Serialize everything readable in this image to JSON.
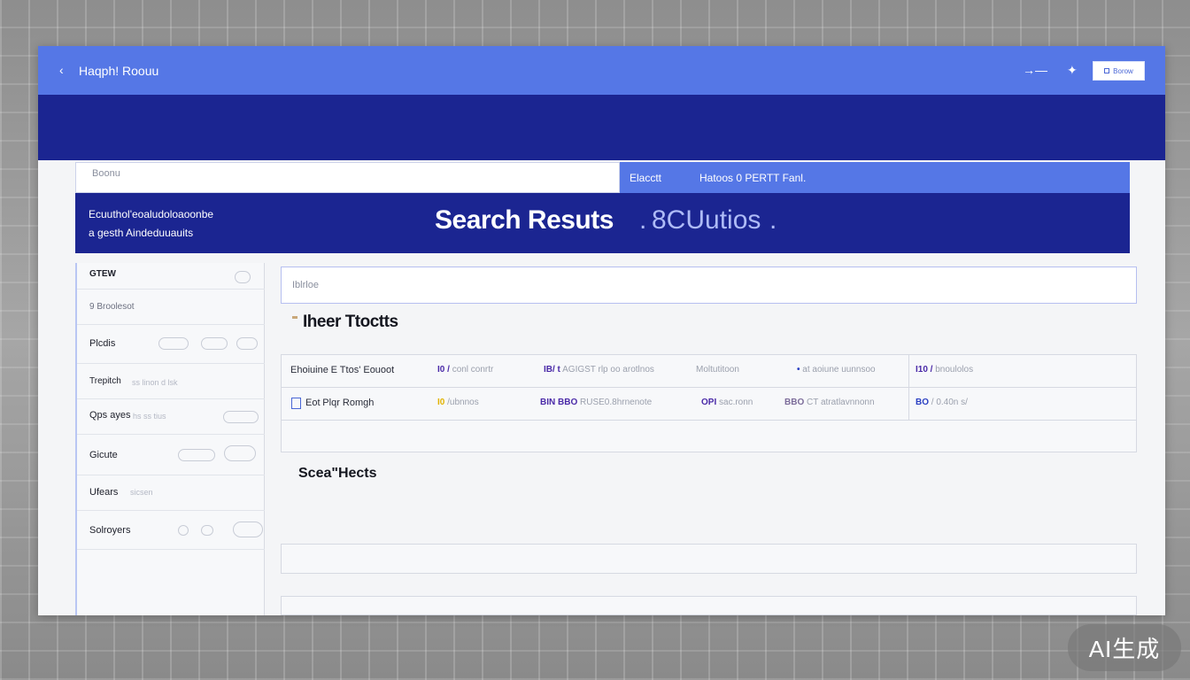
{
  "header": {
    "app_title": "Haqph! Roouu",
    "top_button_label": "Borow"
  },
  "search": {
    "placeholder": "Boonu",
    "filter_primary": "Elacctt",
    "filter_secondary": "Hatoos 0 PERTT Fanl."
  },
  "hero": {
    "subtitle_line1": "Ecuuthol'eoaludoloaoonbe",
    "subtitle_line2": "a gesth Aindeduuauits",
    "title": "Search Resuts",
    "title_sep": ".",
    "title_count": "8CUutios",
    "title_dot": "."
  },
  "sidebar": {
    "items": [
      {
        "label": "GTEW",
        "meta": ""
      },
      {
        "label": "9 Broolesot",
        "meta": ""
      },
      {
        "label": "Plcdis",
        "meta": ""
      },
      {
        "label": "Trepitch",
        "meta": "ss  linon      d  lsk"
      },
      {
        "label": "Qps ayes",
        "meta": "hs  ss  tius"
      },
      {
        "label": "Gicute",
        "meta": ""
      },
      {
        "label": "Ufears",
        "meta": "sicsen"
      },
      {
        "label": "Solroyers",
        "meta": ""
      }
    ]
  },
  "main": {
    "filter_placeholder": "Iblrloe",
    "section1_title": "Iheer Ttoctts",
    "section2_title": "Scea\"Hects",
    "rows": [
      {
        "c1a": "Ehoiuine",
        "c1b": "E Ttos' Eouoot",
        "c2a": "I0 /",
        "c2b": "conl conrtr",
        "c3a": "IB/ t",
        "c3b": "AGIGST rlp oo arotlnos",
        "c4": "Moltutitoon",
        "c5a": "•",
        "c5b": "at aoiune uunnsoo",
        "c6a": "I10 /",
        "c6b": "bnoulolos"
      },
      {
        "c1a": "Eot",
        "c1b": "Plqr Romgh",
        "c2a": "I0",
        "c2b": "/ubnnos",
        "c3a": "BIN BBO",
        "c3b": "RUSE0.8hrnenote",
        "c4a": "OPI",
        "c4b": "sac.ronn",
        "c5a": "BBO",
        "c5b": "CT atratlavnnonn",
        "c6a": "BO",
        "c6b": "/ 0.40n s/"
      }
    ]
  },
  "watermark": "AI生成",
  "colors": {
    "topbar": "#5577e6",
    "navy": "#1b2591",
    "accent_purple": "#4a2aa8",
    "accent_yellow": "#e2b300",
    "accent_blue": "#2a3fc2"
  }
}
